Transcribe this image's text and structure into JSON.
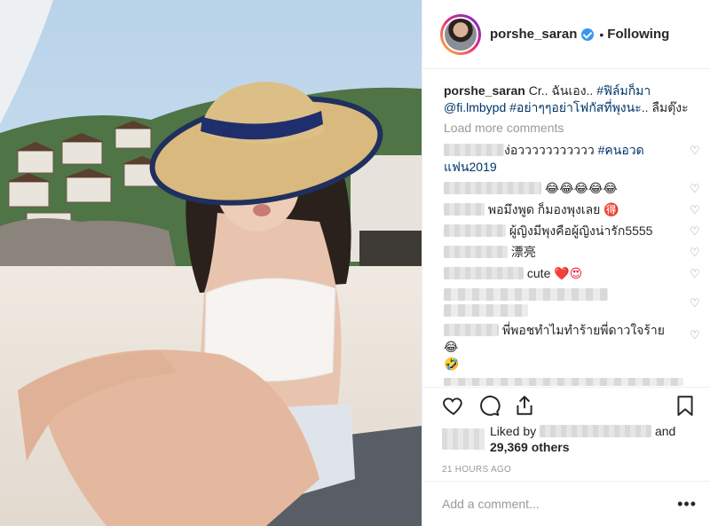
{
  "header": {
    "username": "porshe_saran",
    "separator": "•",
    "follow_status": "Following"
  },
  "caption": {
    "username": "porshe_saran",
    "text": "Cr.. ฉันเอง..",
    "tag1": "#ฟิล์มก็มา",
    "mention": "@fi.lmbypd",
    "tag2": "#อย่าๆๆอย่าโฟกัสที่พุงนะ..",
    "text2": "ลืมตุ๊งะ"
  },
  "load_more": "Load more comments",
  "comments": [
    {
      "text": "ง่อววววววววววว",
      "tag": "#คนอวด",
      "tag2": "แฟน2019"
    },
    {
      "text": "😂😂😂😂😂"
    },
    {
      "text": "พอมึงพูด ก็มองพุงเลย 🉐"
    },
    {
      "text": "ผู้ญิงมีพุงคือผู้ญิงน่ารัก5555"
    },
    {
      "text": "漂亮"
    },
    {
      "text": "cute",
      "emoji": "❤️😍"
    },
    {
      "text": ""
    },
    {
      "text": "พี่พอชทำไมทำร้ายพี่ดาวใจร้าย😂",
      "line2": "🤣"
    }
  ],
  "actions": {
    "liked_by": "Liked by",
    "and": "and",
    "others": "29,369 others",
    "timestamp": "21 HOURS AGO"
  },
  "add_comment": {
    "placeholder": "Add a comment...",
    "more": "•••"
  },
  "icons": {
    "like": "heart-icon",
    "comment": "comment-icon",
    "share": "share-icon",
    "save": "bookmark-icon"
  },
  "colors": {
    "link": "#003569",
    "verified": "#3897f0",
    "muted": "#999999",
    "text": "#262626"
  }
}
